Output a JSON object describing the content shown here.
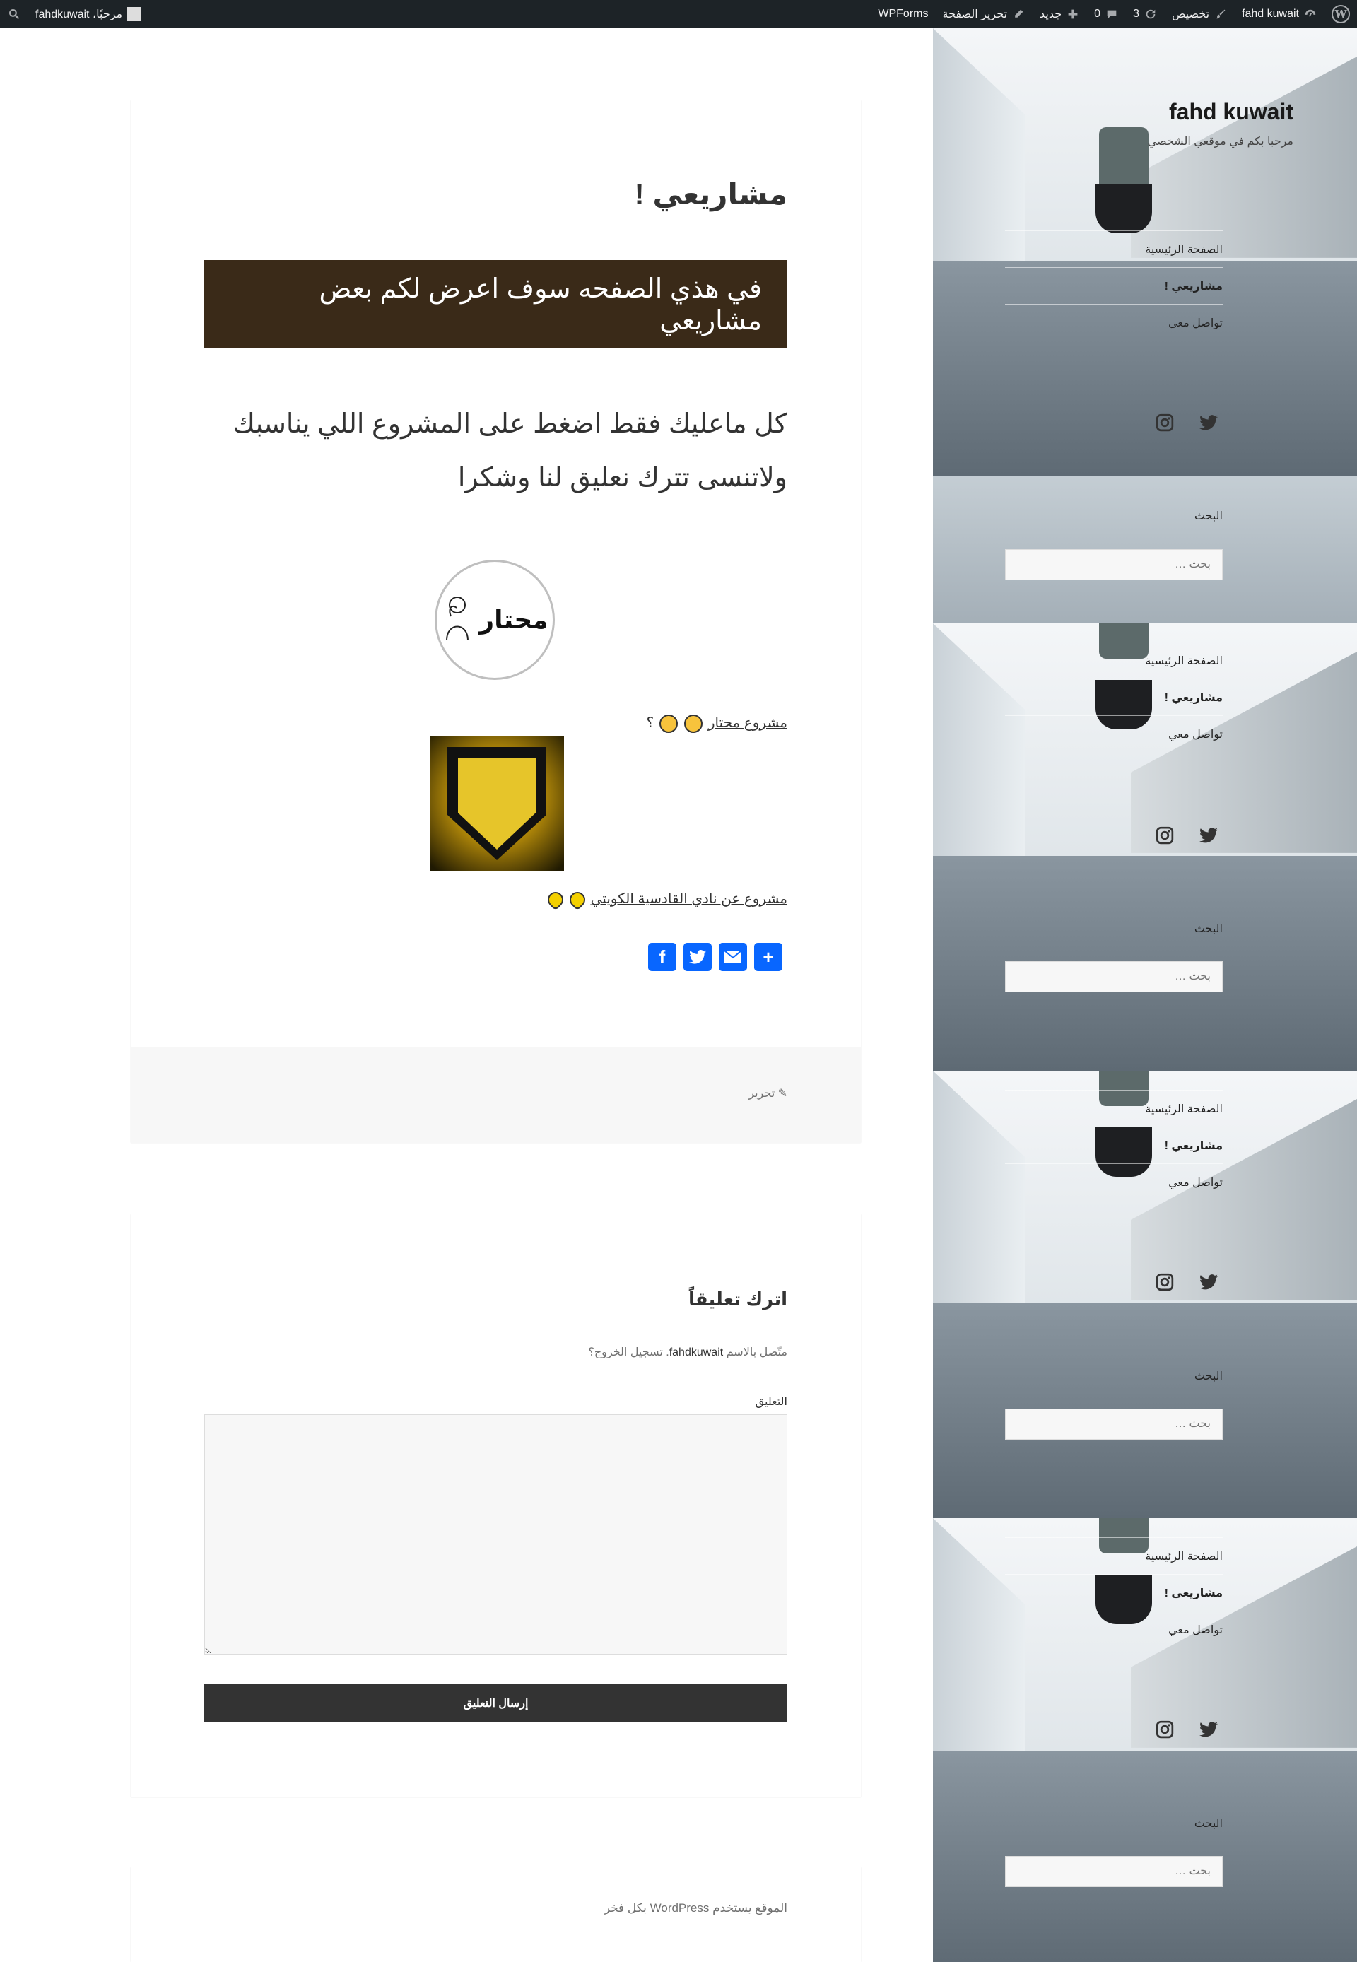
{
  "adminbar": {
    "greeting": "مرحبًا، fahdkuwait",
    "site_name": "fahd kuwait",
    "customize": "تخصيص",
    "updates": "3",
    "comments": "0",
    "new": "جديد",
    "edit_page": "تحرير الصفحة",
    "wpforms": "WPForms"
  },
  "site": {
    "title": "fahd kuwait",
    "description": "مرحبا بكم في موقعي الشخصي"
  },
  "sidebar": {
    "menu": [
      {
        "label": "الصفحة الرئيسية"
      },
      {
        "label": "مشاريعي !"
      },
      {
        "label": "تواصل معي"
      }
    ],
    "social_icons": [
      "twitter-icon",
      "instagram-icon"
    ],
    "search_title": "البحث",
    "search_placeholder": "بحث …"
  },
  "entry": {
    "title": "مشاريعي !",
    "banner": "في هذي الصفحه سوف اعرض لكم بعض مشاريعي",
    "lead_line1": "كل ماعليك فقط اضغط على المشروع اللي يناسبك",
    "lead_line2": "ولاتنسى تترك نعليق لنا وشكرا",
    "logo_name": "محتار",
    "project1": "مشروع محتار",
    "project1_suffix": "؟",
    "project2": "مشروع عن نادي القادسية الكويتي",
    "share_buttons": [
      "facebook-icon",
      "twitter-icon",
      "email-icon",
      "share-plus-icon"
    ],
    "edit_label": "تحرير"
  },
  "comments": {
    "title": "اترك تعليقاً",
    "logged_prefix": "متّصل بالاسم",
    "logged_user": "fahdkuwait",
    "logout": "تسجيل الخروج؟",
    "field_label": "التعليق",
    "submit": "إرسال التعليق"
  },
  "footer": {
    "prefix": "الموقع يستخدم",
    "link": "WordPress",
    "suffix": "بكل فخر"
  }
}
